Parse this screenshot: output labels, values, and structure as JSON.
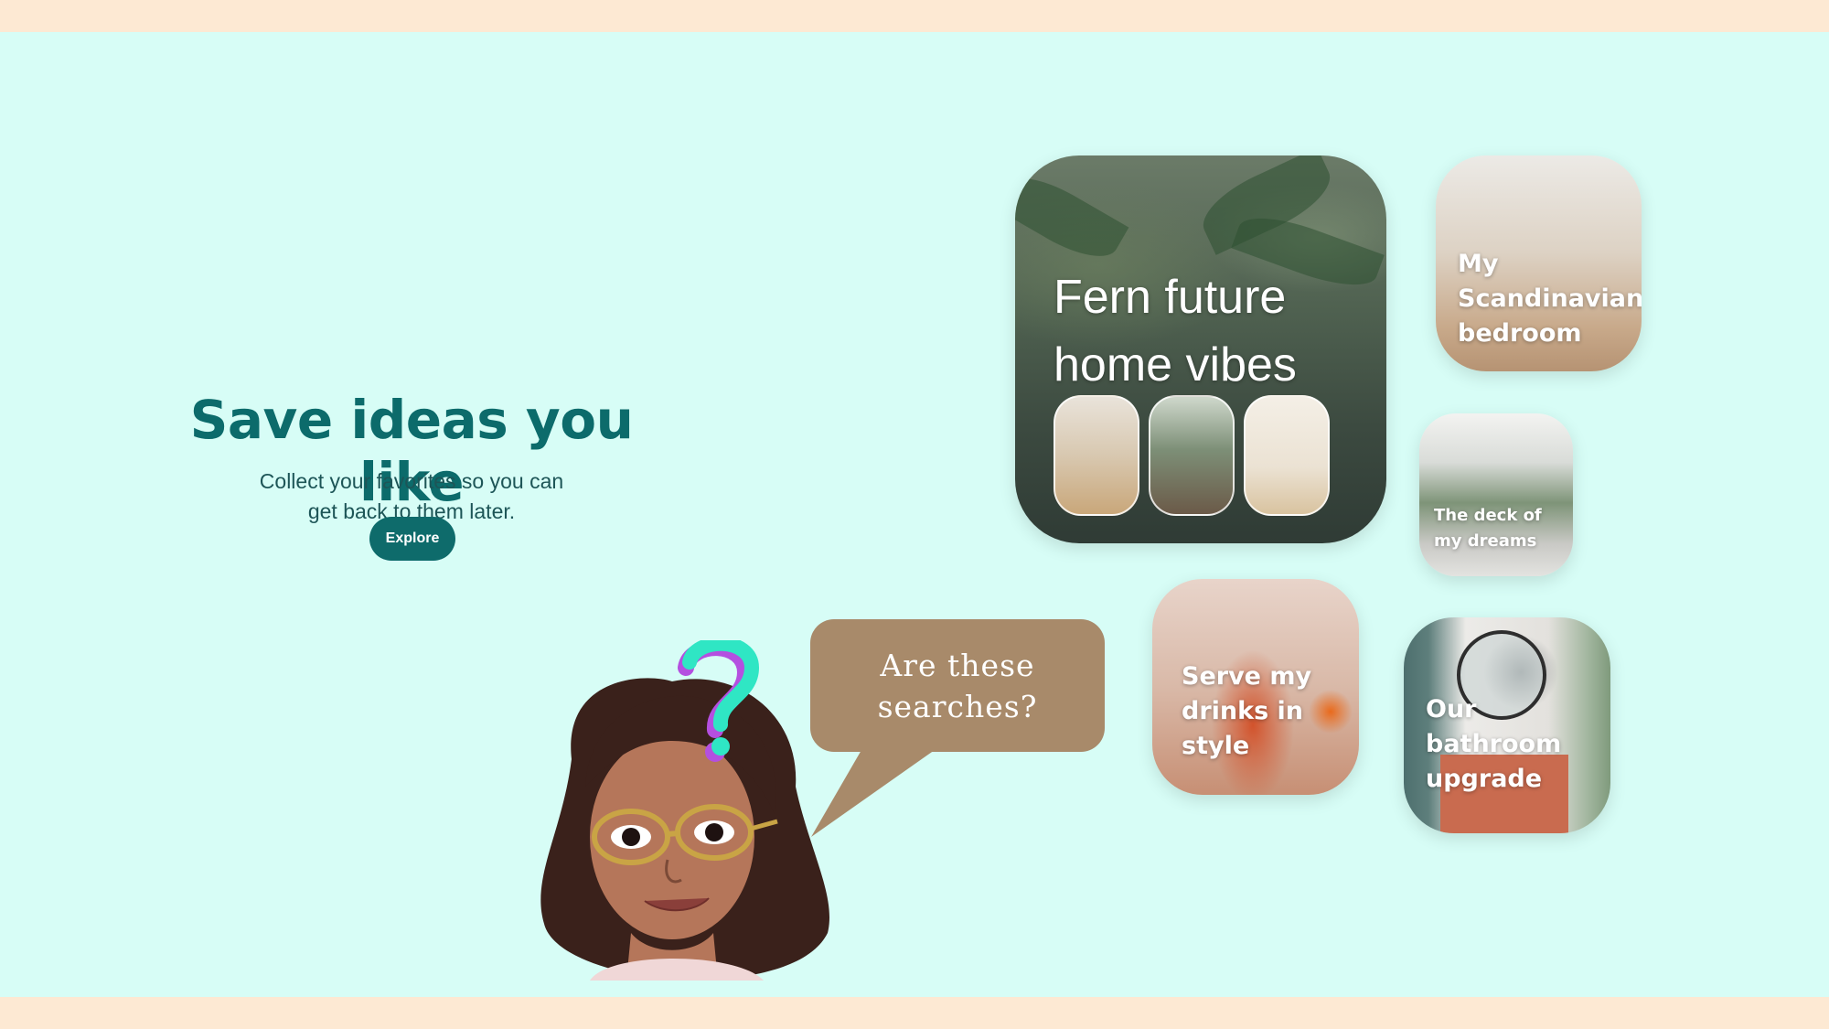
{
  "hero": {
    "title": "Save ideas you like",
    "subtitle_line1": "Collect your favorites so you can",
    "subtitle_line2": "get back to them later.",
    "cta_label": "Explore"
  },
  "boards": {
    "fern": {
      "title_line1": "Fern future",
      "title_line2": "home vibes"
    },
    "scandi": {
      "line1": "My",
      "line2": "Scandinavian",
      "line3": "bedroom"
    },
    "deck": {
      "line1": "The deck of",
      "line2": "my dreams"
    },
    "drinks": {
      "line1": "Serve my",
      "line2": "drinks in",
      "line3": "style"
    },
    "bath": {
      "line1": "Our",
      "line2": "bathroom",
      "line3": "upgrade"
    }
  },
  "speech_bubble": {
    "line1": "Are these",
    "line2": "searches?"
  },
  "colors": {
    "page_band": "#fde9d3",
    "background": "#d7fdf6",
    "brand_teal": "#0c6b6b",
    "bubble": "#a88a6a",
    "question_mark_teal": "#2fe6c4",
    "question_mark_purple": "#b44fe0"
  },
  "icons": {
    "avatar": "bitmoji-avatar-icon",
    "question": "question-mark-icon"
  }
}
